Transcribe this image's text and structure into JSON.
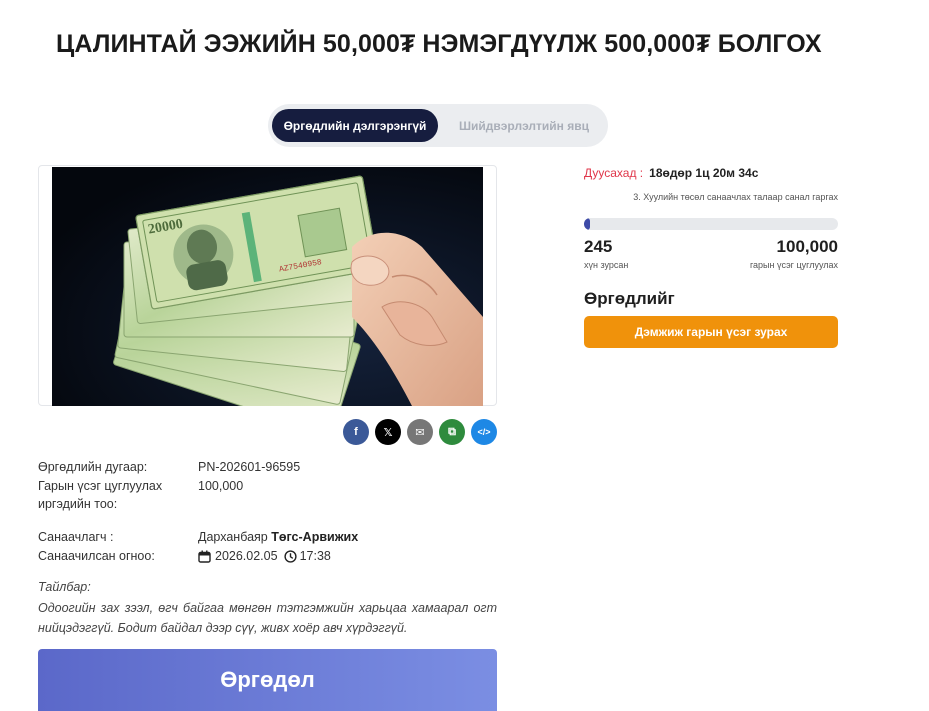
{
  "petition": {
    "title": "ЦАЛИНТАЙ ЭЭЖИЙН 50,000₮ НЭМЭГДҮҮЛЖ 500,000₮ БОЛГОХ"
  },
  "tabs": [
    {
      "label": "Өргөдлийн дэлгэрэнгүй",
      "active": true
    },
    {
      "label": "Шийдвэрлэлтийн явц",
      "active": false
    }
  ],
  "image": {
    "alt": "hand holding 20000 tugrik banknotes",
    "banknote_text": "20000",
    "serial": "AZ7540958"
  },
  "share": [
    {
      "name": "facebook",
      "glyph": "f",
      "color": "#3b5998"
    },
    {
      "name": "x",
      "glyph": "𝕏",
      "color": "#000000"
    },
    {
      "name": "email",
      "glyph": "✉",
      "color": "#777777"
    },
    {
      "name": "copy",
      "glyph": "⧉",
      "color": "#2e8b3d"
    },
    {
      "name": "embed",
      "glyph": "</>",
      "color": "#1e88e5"
    }
  ],
  "details": {
    "number_label": "Өргөдлийн дугаар:",
    "number_value": "PN-202601-96595",
    "signatures_label_line1": "Гарын үсэг цуглуулах",
    "signatures_label_line2": "иргэдийн тоо:",
    "signatures_value": "100,000",
    "initiator_label": "Санаачлагч :",
    "initiator_first": "Дарханбаяр",
    "initiator_last": "Төгс-Арвижих",
    "date_label": "Санаачилсан огноо:",
    "date_value": "2026.02.05",
    "time_value": "17:38",
    "description_label": "Тайлбар:",
    "description": "Одоогийн зах зээл, өгч байгаа мөнгөн тэтгэмжийн харьцаа хамаарал огт нийцэдэггүй. Бодит байдал дээр сүү, живх хоёр авч хүрдэггүй."
  },
  "sign_button": "Өргөдөл",
  "sidebar": {
    "deadline_label": "Дуусахад :",
    "deadline_value": "18өдөр 1ц 20м 34с",
    "stage": "3. Хуулийн төсөл санаачлах талаар санал гаргах",
    "progress_fraction": 0.00245,
    "signed_count": "245",
    "signed_label": "хүн зурсан",
    "target_count": "100,000",
    "target_label": "гарын үсэг цуглуулах",
    "sign_heading": "Өргөдлийг",
    "support_button": "Дэмжиж гарын үсэг зурах"
  },
  "colors": {
    "tab_active": "#161d3f",
    "deadline": "#e0364a",
    "progress": "#3d4aa7",
    "support_button": "#f0920b",
    "sign_button_start": "#5b68c9",
    "sign_button_end": "#7b8ee3"
  }
}
